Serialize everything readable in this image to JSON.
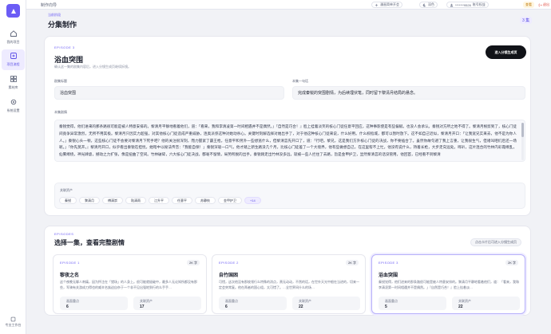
{
  "sidebar": {
    "items": [
      {
        "label": "我的项目",
        "icon": "home-icon"
      },
      {
        "label": "项目流程",
        "icon": "workflow-icon"
      },
      {
        "label": "素材库",
        "icon": "library-icon"
      },
      {
        "label": "系统设置",
        "icon": "gear-icon"
      }
    ],
    "footer_label": "专业工作台"
  },
  "topbar": {
    "title": "制作向导",
    "theme_label": "漫画简单开会",
    "mode_label": "深色",
    "phone": "*******9526",
    "account_label": "账号权益",
    "badge": "查看",
    "exit_label": "退出"
  },
  "header": {
    "crumb": "当前阶段",
    "title": "分集制作",
    "count": "3 集"
  },
  "episode_detail": {
    "tag": "EPISODE 3",
    "title": "浴血突围",
    "subtitle": "确认这一集的剧集内容后，进入分镜生成页继续拆镜。",
    "enter_button": "进入分镜生成页",
    "title_field": {
      "label": "剧集标题",
      "value": "浴血突围"
    },
    "summary_field": {
      "label": "本集一句话",
      "value": "完成秦锐的突围剧情，为后续埋伏笔，同时留下黎清月结局的悬念。"
    },
    "script_label": "本集剧情",
    "script_text": "秦锐觉得，他们进来的那条路很可能是被人特意安排的。黎清月平静地看着他们，道：「看来，我和李清凌第一时间相遇并不是偶然。」『自然是巧合！』脸上挂着淡笑的核心门徒任意平回应，这种事影使是有些偏赋。也没人会承认。秦锐对方所之地不得了。黎清月根剪到了，核心门徒间竟争异常激烈，无所不用其极。黎清月只因实力超强，对其他核心门徒造成严重威胁，连奥派弥这种对她动杀心。关键时刻解选择对她出手了，对于他这种核心门徒来说，什么好用。什么棕指城，都可以暂时放下。这不如自己近似，黎清月开口：「让我宽兄实来去，他不是为你人人。」秦锐心头一顿，这些核心门徒不会要对黎清月下死手吧？他的关注很深刻，而力握紧了霸王枪。任意平和另外一些想逃什么，但黎清昙先开口了，道：「行吧。黎兄，这是我们方外核心门徒的决战，你不要插合了。虽然你故句避了我上言重，让我很生气，但诸叫咱们后还一场呢。」『你先莫开。』黎清月开口，似乎看出秦锐在担忧，她暗中以秘法传音：「我能自保！」秦锐深吸一口气，他才踏上新生路没几个月，比核心门徒差了一个大境界，他有些做想自己，在这里帮不上忙。他没有说什么，持着长枪，大步走向远处。哗叭，这片连合的竹林内彩霞缭乱，仙雾缭绕，神光肆虐，撼动之力扩张，像是扭曲了空间。竹林破碎，六大核心门徒决战，都毫不留情，局势所脱的出手。秦锐刚走出竹林没多远，就被一些人拦住了去路，旨是金甲护卫，显然黎清昙的话没管用，他回首，已经看不到黎清",
    "characters_label": "关联资产",
    "characters": [
      "秦锐",
      "黎清月",
      "傅清崇",
      "陆清雨",
      "江升平",
      "任意平",
      "苏静枝",
      "金甲护卫"
    ],
    "more_chip": "+14"
  },
  "episodes": {
    "tag": "EPISODES",
    "title": "选择一集，查看完整剧情",
    "hint": "点击卡片后可进入分镜生成页",
    "stat_labels": {
      "scenes": "画面重点",
      "assets": "关联资产"
    },
    "items": [
      {
        "tag": "EPISODE 1",
        "size": "2K 字",
        "title": "黎夜之名",
        "desc": "这个夜晚无聊人刺痛，因为怀注在「猎场」的人身上。很可能就极破中，最多人无论知所都没有那些，军骑有关游成刀得也的威辛名族迫自杂于一个非不见出强地到行的么手手…",
        "scenes": "6",
        "assets": "17"
      },
      {
        "tag": "EPISODE 2",
        "size": "2K 字",
        "title": "自竹国困",
        "desc": "可惜，这次他没有那枚领行么特殊的消点，萧无动动，不然的话，在世外天光中根在当进的，切来一定会突常复。他在两者的国心组，太可惜了。…全世界间什么的场…",
        "scenes": "6",
        "assets": "22"
      },
      {
        "tag": "EPISODE 3",
        "size": "2K 字",
        "title": "浴血突围",
        "desc": "秦锐觉得，他们进来的那条路很可能是被人特意安排的。黎清月平静地看着他们，道：「看来，我和李清凌第一时间相遇并不是偶然。」『自然是巧合！』脸上挂着淡…",
        "scenes": "5",
        "assets": "22",
        "selected": true
      }
    ]
  },
  "colors": {
    "accent": "#6b5cf5",
    "dark_button": "#111318",
    "exit": "#e0453a"
  }
}
